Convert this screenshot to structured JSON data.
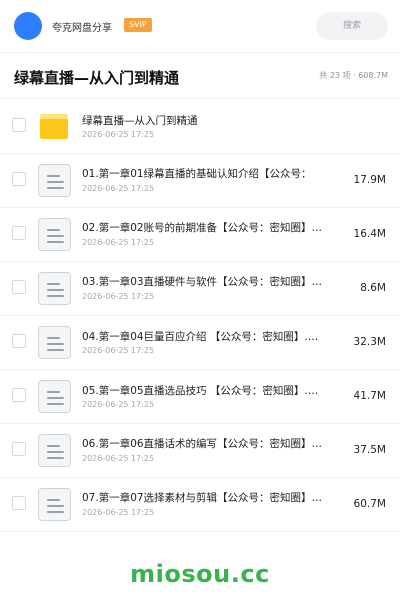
{
  "header": {
    "user_name": "夸克网盘分享",
    "vip_label": "SVIP",
    "search_label": "搜索"
  },
  "folder": {
    "title": "绿幕直播—从入门到精通",
    "stats": "共 23 项 · 608.7M"
  },
  "files": [
    {
      "type": "folder",
      "icon": "folder-icon",
      "name": "绿幕直播—从入门到精通",
      "date": "2026-06-25 17:25",
      "size": ""
    },
    {
      "type": "doc",
      "icon": "document-icon",
      "name": "01.第一章01绿幕直播的基础认知介绍【公众号：",
      "date": "2026-06-25 17:25",
      "size": "17.9M"
    },
    {
      "type": "doc",
      "icon": "document-icon",
      "name": "02.第一章02账号的前期准备【公众号：密知圈】…",
      "date": "2026-06-25 17:25",
      "size": "16.4M"
    },
    {
      "type": "doc",
      "icon": "document-icon",
      "name": "03.第一章03直播硬件与软件【公众号：密知圈】…",
      "date": "2026-06-25 17:25",
      "size": "8.6M"
    },
    {
      "type": "doc",
      "icon": "document-icon",
      "name": "04.第一章04巨量百应介绍 【公众号：密知圈】.…",
      "date": "2026-06-25 17:25",
      "size": "32.3M"
    },
    {
      "type": "doc",
      "icon": "document-icon",
      "name": "05.第一章05直播选品技巧 【公众号：密知圈】.…",
      "date": "2026-06-25 17:25",
      "size": "41.7M"
    },
    {
      "type": "doc",
      "icon": "document-icon",
      "name": "06.第一章06直播话术的编写【公众号：密知圈】…",
      "date": "2026-06-25 17:25",
      "size": "37.5M"
    },
    {
      "type": "doc",
      "icon": "document-icon",
      "name": "07.第一章07选择素材与剪辑【公众号：密知圈】…",
      "date": "2026-06-25 17:25",
      "size": "60.7M"
    }
  ],
  "watermark": "miosou.cc",
  "colors": {
    "accent": "#2f7dff",
    "vip": "#f9a13a",
    "folder": "#ffc61a",
    "watermark": "#36b34a"
  }
}
